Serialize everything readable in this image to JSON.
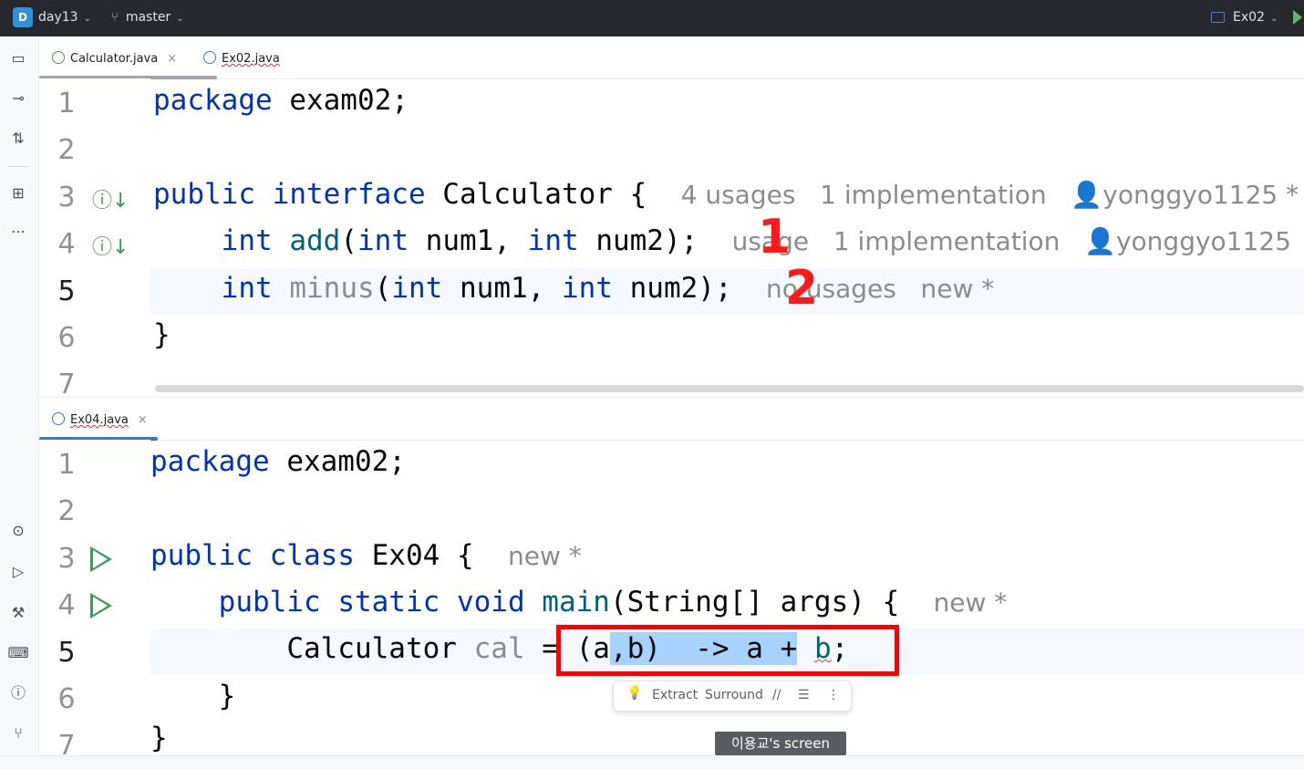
{
  "titlebar": {
    "project_badge": "D",
    "project": "day13",
    "branch": "master",
    "run_config": "Ex02"
  },
  "top_pane": {
    "tabs": [
      {
        "label": "Calculator.java",
        "close": "×"
      },
      {
        "label": "Ex02.java"
      }
    ],
    "lines": [
      "1",
      "2",
      "3",
      "4",
      "5",
      "6",
      "7"
    ],
    "code": {
      "l1_kw": "package",
      "l1_rest": " exam02;",
      "l3_kw1": "public",
      "l3_kw2": "interface",
      "l3_rest": " Calculator {",
      "l3_hint": "4 usages   1 implementation   ",
      "l3_author": "yonggyo1125 *",
      "l4_kw": "int",
      "l4_fn": "add",
      "l4_p1": "(",
      "l4_kw2": "int",
      "l4_a1": " num1, ",
      "l4_kw3": "int",
      "l4_a2": " num2);",
      "l4_hint": "usage   1 implementation   ",
      "l4_author": "yonggyo1125",
      "l5_kw": "int",
      "l5_fn": "minus",
      "l5_p1": "(",
      "l5_kw2": "int",
      "l5_a1": " num1, ",
      "l5_kw3": "int",
      "l5_a2": " num2);",
      "l5_hint": "no usages   new *",
      "l6": "}"
    },
    "annotations": [
      "1",
      "2"
    ]
  },
  "bottom_pane": {
    "tabs": [
      {
        "label": "Ex04.java",
        "close": "×"
      }
    ],
    "lines": [
      "1",
      "2",
      "3",
      "4",
      "5",
      "6",
      "7"
    ],
    "code": {
      "l1_kw": "package",
      "l1_rest": " exam02;",
      "l3_kw1": "public",
      "l3_kw2": "class",
      "l3_rest": " Ex04 {",
      "l3_hint": "new *",
      "l4_kw1": "public",
      "l4_kw2": "static",
      "l4_kw3": "void",
      "l4_fn": "main",
      "l4_rest": "(String[] args) {",
      "l4_hint": "new *",
      "l5_type": "Calculator ",
      "l5_var": "cal",
      "l5_eq": " = ",
      "l5_open": "(a",
      "l5_sel1": ",b)  -> a +",
      "l5_sp": " ",
      "l5_b": "b",
      "l5_end": ";",
      "l6": "}",
      "l7": "}"
    }
  },
  "intention_popup": {
    "extract": "Extract",
    "surround": "Surround",
    "comment": "//",
    "more": "⋮"
  },
  "screen_label": "이용교's screen"
}
